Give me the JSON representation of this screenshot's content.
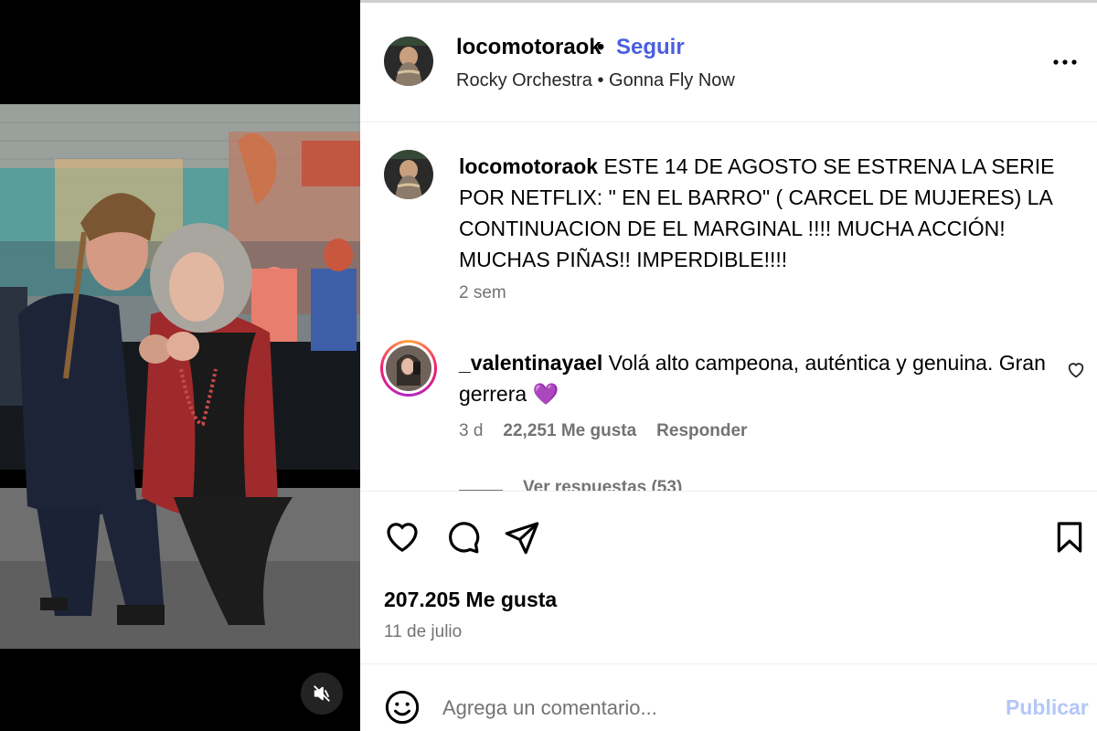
{
  "post": {
    "username": "locomotoraok",
    "follow_label": "Seguir",
    "header_separator": "•",
    "music": "Rocky Orchestra • Gonna Fly Now",
    "caption_username": "locomotoraok",
    "caption_text": "ESTE 14 DE AGOSTO SE ESTRENA LA SERIE POR NETFLIX: \" EN EL BARRO\" ( CARCEL DE MUJERES) LA CONTINUACION DE EL MARGINAL !!!! MUCHA ACCIÓN! MUCHAS PIÑAS!! IMPERDIBLE!!!!",
    "caption_time": "2 sem",
    "likes_label": "207.205 Me gusta",
    "date": "11 de julio"
  },
  "comment": {
    "username": "_valentinayael",
    "text": "Volá alto campeona, auténtica y genuina. Gran gerrera",
    "emoji": "💜",
    "time": "3 d",
    "likes_label": "22,251 Me gusta",
    "reply_label": "Responder",
    "view_replies": "Ver respuestas (53)"
  },
  "composer": {
    "placeholder": "Agrega un comentario...",
    "publish_label": "Publicar"
  },
  "icons": {
    "more": "more-horizontal-icon",
    "like": "heart-icon",
    "comment": "comment-bubble-icon",
    "share": "paper-plane-icon",
    "save": "bookmark-icon",
    "emoji": "smiley-icon",
    "mute": "speaker-muted-icon"
  },
  "colors": {
    "follow": "#4a5fe0",
    "publish_disabled": "#b3c7f7",
    "muted_text": "#737373"
  }
}
